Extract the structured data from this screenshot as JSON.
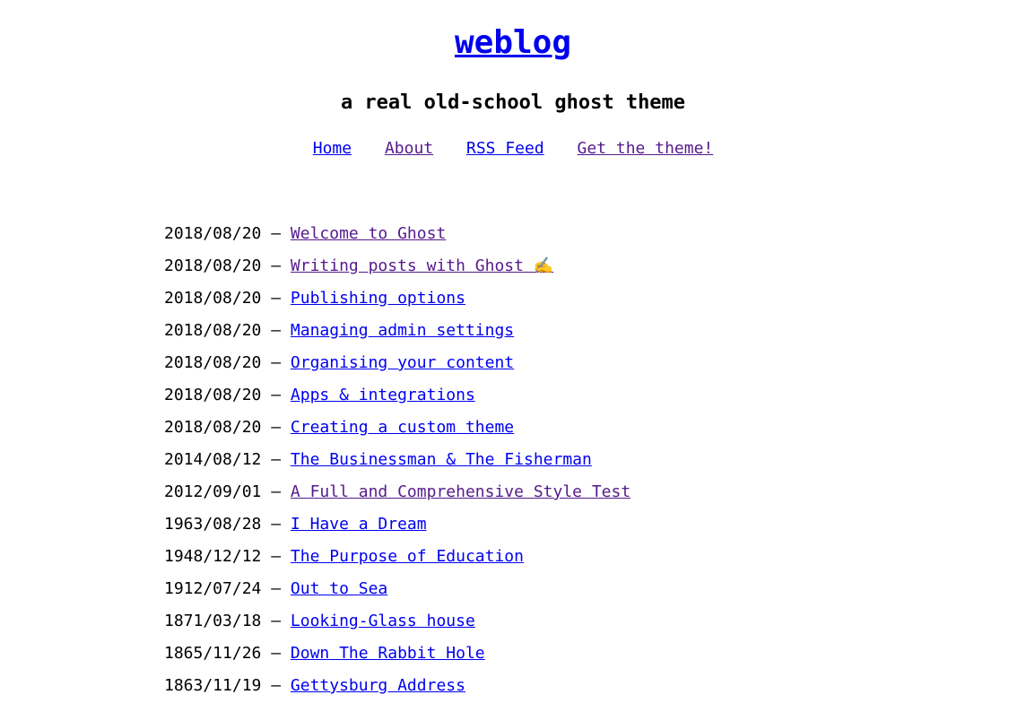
{
  "site": {
    "title": "weblog",
    "tagline": "a real old-school ghost theme"
  },
  "nav": [
    {
      "label": "Home",
      "visited": false
    },
    {
      "label": "About",
      "visited": true
    },
    {
      "label": "RSS Feed",
      "visited": false
    },
    {
      "label": "Get the theme!",
      "visited": true
    }
  ],
  "separator": " — ",
  "posts": [
    {
      "date": "2018/08/20",
      "title": "Welcome to Ghost",
      "visited": true
    },
    {
      "date": "2018/08/20",
      "title": "Writing posts with Ghost ✍️",
      "visited": true
    },
    {
      "date": "2018/08/20",
      "title": "Publishing options",
      "visited": false
    },
    {
      "date": "2018/08/20",
      "title": "Managing admin settings",
      "visited": false
    },
    {
      "date": "2018/08/20",
      "title": "Organising your content",
      "visited": false
    },
    {
      "date": "2018/08/20",
      "title": "Apps & integrations",
      "visited": false
    },
    {
      "date": "2018/08/20",
      "title": "Creating a custom theme",
      "visited": false
    },
    {
      "date": "2014/08/12",
      "title": "The Businessman & The Fisherman",
      "visited": false
    },
    {
      "date": "2012/09/01",
      "title": "A Full and Comprehensive Style Test",
      "visited": true
    },
    {
      "date": "1963/08/28",
      "title": "I Have a Dream",
      "visited": false
    },
    {
      "date": "1948/12/12",
      "title": "The Purpose of Education",
      "visited": false
    },
    {
      "date": "1912/07/24",
      "title": "Out to Sea",
      "visited": false
    },
    {
      "date": "1871/03/18",
      "title": "Looking-Glass house",
      "visited": false
    },
    {
      "date": "1865/11/26",
      "title": "Down The Rabbit Hole",
      "visited": false
    },
    {
      "date": "1863/11/19",
      "title": "Gettysburg Address",
      "visited": false
    }
  ],
  "colors": {
    "link": "#0000ee",
    "visited_link": "#551a8b",
    "text": "#000000",
    "background": "#ffffff"
  }
}
